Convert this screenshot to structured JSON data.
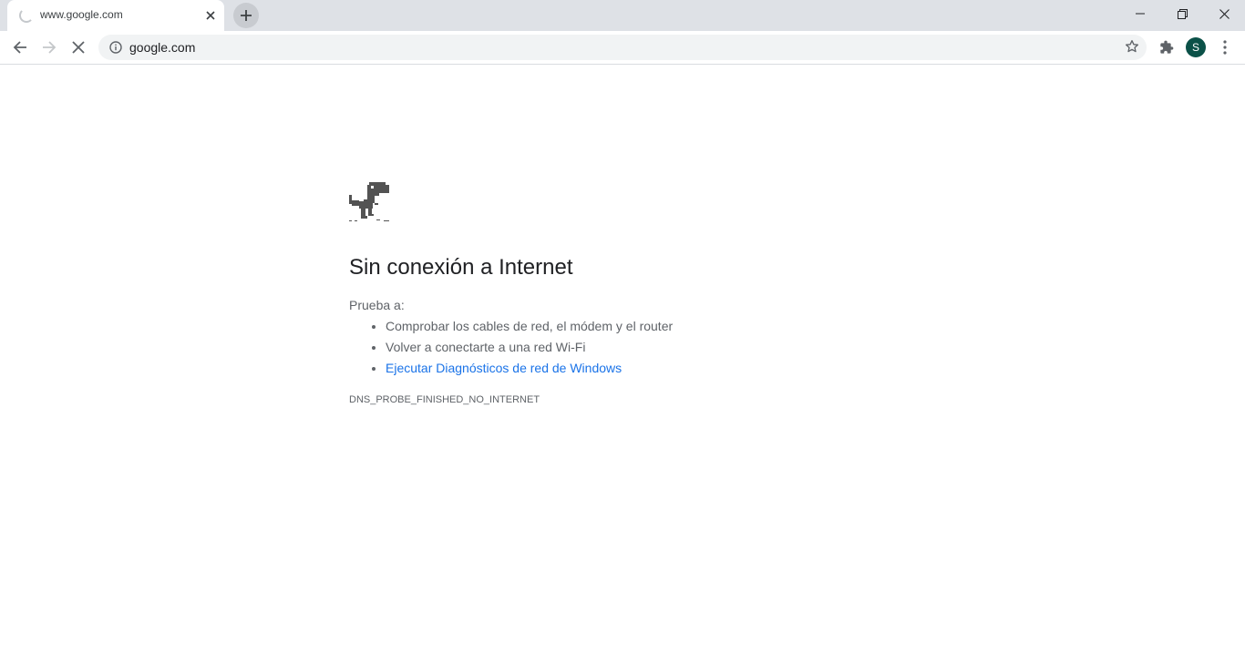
{
  "tab": {
    "title": "www.google.com"
  },
  "toolbar": {
    "url": "google.com",
    "profile_initial": "S"
  },
  "error": {
    "heading": "Sin conexión a Internet",
    "suggestions_title": "Prueba a:",
    "suggestions": [
      "Comprobar los cables de red, el módem y el router",
      "Volver a conectarte a una red Wi-Fi",
      "Ejecutar Diagnósticos de red de Windows"
    ],
    "code": "DNS_PROBE_FINISHED_NO_INTERNET"
  },
  "colors": {
    "link": "#1a73e8",
    "avatar": "#0b5148",
    "tabstrip": "#dee1e6"
  },
  "icons": [
    "loading-spinner-icon",
    "close-icon",
    "plus-icon",
    "minimize-icon",
    "restore-icon",
    "window-close-icon",
    "back-arrow-icon",
    "forward-arrow-icon",
    "stop-icon",
    "info-icon",
    "star-icon",
    "extensions-puzzle-icon",
    "menu-dots-icon",
    "dino-icon"
  ]
}
